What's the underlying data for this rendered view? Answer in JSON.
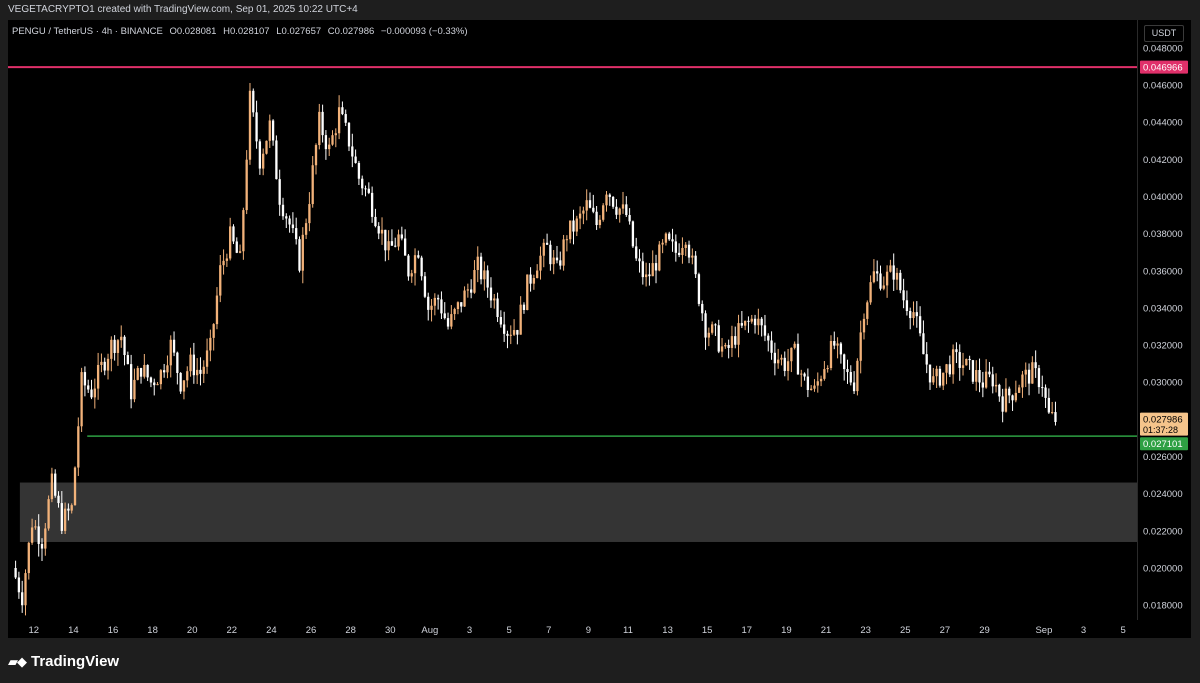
{
  "header": {
    "attribution": "VEGETACRYPTO1 created with TradingView.com, Sep 01, 2025 10:22 UTC+4"
  },
  "legend": {
    "symbol": "PENGU / TetherUS · 4h · BINANCE",
    "open": "O0.028081",
    "high": "H0.028107",
    "low": "L0.027657",
    "close": "C0.027986",
    "change": "−0.000093 (−0.33%)"
  },
  "currency": "USDT",
  "footer": {
    "logo_text": "TradingView",
    "logo_icon": "tradingview-logo-icon"
  },
  "colors": {
    "background": "#000000",
    "bull_candle": "#f2b27a",
    "bear_candle": "#ffffff",
    "resistance": "#e0306a",
    "support": "#2ea043",
    "zone": "#3d3d3d",
    "price_tag": "#f5c48b"
  },
  "chart_data": {
    "type": "candlestick",
    "interval": "4h",
    "ylim": [
      0.0172,
      0.0495
    ],
    "y_ticks": [
      "0.048000",
      "0.046000",
      "0.044000",
      "0.042000",
      "0.040000",
      "0.038000",
      "0.036000",
      "0.034000",
      "0.032000",
      "0.030000",
      "0.028000",
      "0.026000",
      "0.024000",
      "0.022000",
      "0.020000",
      "0.018000"
    ],
    "x_ticks": [
      "12",
      "14",
      "16",
      "18",
      "20",
      "22",
      "24",
      "26",
      "28",
      "30",
      "Aug",
      "3",
      "5",
      "7",
      "9",
      "11",
      "13",
      "15",
      "17",
      "19",
      "21",
      "23",
      "25",
      "27",
      "29",
      "Sep",
      "3",
      "5"
    ],
    "x_tick_days": [
      12,
      14,
      16,
      18,
      20,
      22,
      24,
      26,
      28,
      30,
      32,
      34,
      36,
      38,
      40,
      42,
      44,
      46,
      48,
      50,
      52,
      54,
      56,
      58,
      60,
      63,
      65,
      67
    ],
    "day_range": [
      10.7,
      67.7
    ],
    "horizontal_levels": [
      {
        "name": "resistance",
        "value": 0.046966,
        "label": "0.046966"
      },
      {
        "name": "support",
        "value": 0.027101,
        "label": "0.027101"
      }
    ],
    "zone": {
      "low": 0.0214,
      "high": 0.0246
    },
    "last_price": {
      "value": 0.027986,
      "label": "0.027986",
      "countdown": "01:37:28"
    },
    "path": [
      [
        11.0,
        0.02
      ],
      [
        11.5,
        0.0185
      ],
      [
        12.0,
        0.0225
      ],
      [
        12.5,
        0.0215
      ],
      [
        13.0,
        0.0245
      ],
      [
        13.5,
        0.0225
      ],
      [
        14.0,
        0.0232
      ],
      [
        14.5,
        0.03
      ],
      [
        15.0,
        0.0295
      ],
      [
        15.5,
        0.0308
      ],
      [
        16.0,
        0.032
      ],
      [
        16.5,
        0.0325
      ],
      [
        17.0,
        0.0295
      ],
      [
        17.5,
        0.0308
      ],
      [
        18.0,
        0.03
      ],
      [
        18.5,
        0.0305
      ],
      [
        19.0,
        0.032
      ],
      [
        19.5,
        0.03
      ],
      [
        20.0,
        0.031
      ],
      [
        20.5,
        0.0305
      ],
      [
        21.0,
        0.0318
      ],
      [
        21.5,
        0.036
      ],
      [
        22.0,
        0.0378
      ],
      [
        22.5,
        0.0365
      ],
      [
        23.0,
        0.0452
      ],
      [
        23.5,
        0.042
      ],
      [
        24.0,
        0.0438
      ],
      [
        24.5,
        0.04
      ],
      [
        25.0,
        0.0385
      ],
      [
        25.5,
        0.0365
      ],
      [
        26.0,
        0.04
      ],
      [
        26.5,
        0.044
      ],
      [
        27.0,
        0.0425
      ],
      [
        27.5,
        0.0445
      ],
      [
        28.0,
        0.043
      ],
      [
        28.5,
        0.041
      ],
      [
        29.0,
        0.04
      ],
      [
        29.5,
        0.0385
      ],
      [
        30.0,
        0.037
      ],
      [
        30.5,
        0.0378
      ],
      [
        31.0,
        0.036
      ],
      [
        31.5,
        0.0372
      ],
      [
        32.0,
        0.034
      ],
      [
        32.5,
        0.0345
      ],
      [
        33.0,
        0.033
      ],
      [
        33.5,
        0.034
      ],
      [
        34.0,
        0.035
      ],
      [
        34.5,
        0.0362
      ],
      [
        35.0,
        0.0352
      ],
      [
        35.5,
        0.034
      ],
      [
        36.0,
        0.0328
      ],
      [
        36.5,
        0.033
      ],
      [
        37.0,
        0.0352
      ],
      [
        37.5,
        0.0365
      ],
      [
        38.0,
        0.0372
      ],
      [
        38.5,
        0.036
      ],
      [
        39.0,
        0.038
      ],
      [
        39.5,
        0.0385
      ],
      [
        40.0,
        0.0395
      ],
      [
        40.5,
        0.0385
      ],
      [
        41.0,
        0.0405
      ],
      [
        41.5,
        0.0395
      ],
      [
        42.0,
        0.039
      ],
      [
        42.5,
        0.0365
      ],
      [
        43.0,
        0.0355
      ],
      [
        43.5,
        0.0365
      ],
      [
        44.0,
        0.0375
      ],
      [
        44.5,
        0.037
      ],
      [
        45.0,
        0.038
      ],
      [
        45.5,
        0.0355
      ],
      [
        46.0,
        0.033
      ],
      [
        46.5,
        0.0325
      ],
      [
        47.0,
        0.0315
      ],
      [
        47.5,
        0.0325
      ],
      [
        48.0,
        0.033
      ],
      [
        48.5,
        0.0335
      ],
      [
        49.0,
        0.0325
      ],
      [
        49.5,
        0.0315
      ],
      [
        50.0,
        0.031
      ],
      [
        50.5,
        0.0315
      ],
      [
        51.0,
        0.03
      ],
      [
        51.5,
        0.0295
      ],
      [
        52.0,
        0.031
      ],
      [
        52.5,
        0.032
      ],
      [
        53.0,
        0.0305
      ],
      [
        53.5,
        0.03
      ],
      [
        54.0,
        0.034
      ],
      [
        54.5,
        0.0358
      ],
      [
        55.0,
        0.0355
      ],
      [
        55.5,
        0.036
      ],
      [
        56.0,
        0.0345
      ],
      [
        56.5,
        0.0338
      ],
      [
        57.0,
        0.0315
      ],
      [
        57.5,
        0.03
      ],
      [
        58.0,
        0.0305
      ],
      [
        58.5,
        0.0312
      ],
      [
        59.0,
        0.031
      ],
      [
        59.5,
        0.0305
      ],
      [
        60.0,
        0.03
      ],
      [
        60.5,
        0.0302
      ],
      [
        61.0,
        0.029
      ],
      [
        61.5,
        0.0295
      ],
      [
        62.0,
        0.0302
      ],
      [
        62.5,
        0.0305
      ],
      [
        63.0,
        0.03
      ],
      [
        63.3,
        0.0282
      ],
      [
        63.6,
        0.028
      ]
    ]
  }
}
